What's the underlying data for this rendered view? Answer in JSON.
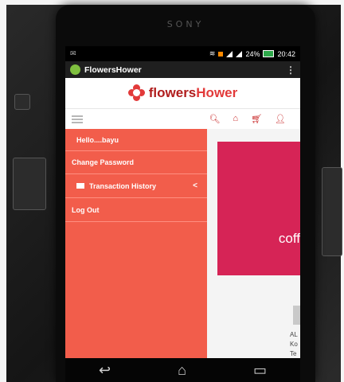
{
  "device": {
    "brand": "SONY"
  },
  "status_bar": {
    "battery": "24%",
    "time": "20:42"
  },
  "action_bar": {
    "title": "FlowersHower",
    "overflow_icon": "⋮"
  },
  "logo": {
    "part1": "flowers",
    "part2": "Hower"
  },
  "toolbar": {
    "icons": [
      "menu-icon",
      "search-icon",
      "home-icon",
      "cart-icon",
      "user-icon"
    ]
  },
  "drawer": {
    "greeting": "Hello....bayu",
    "items": [
      {
        "label": "Change Password"
      },
      {
        "label": "Transaction History",
        "chevron": "<"
      },
      {
        "label": "Log Out"
      }
    ]
  },
  "main": {
    "banner_text": "coff",
    "side_text": [
      "AL",
      "Ko",
      "Te"
    ]
  },
  "colors": {
    "drawer": "#f25d4b",
    "banner": "#d62456",
    "accent": "#c92b2b"
  }
}
